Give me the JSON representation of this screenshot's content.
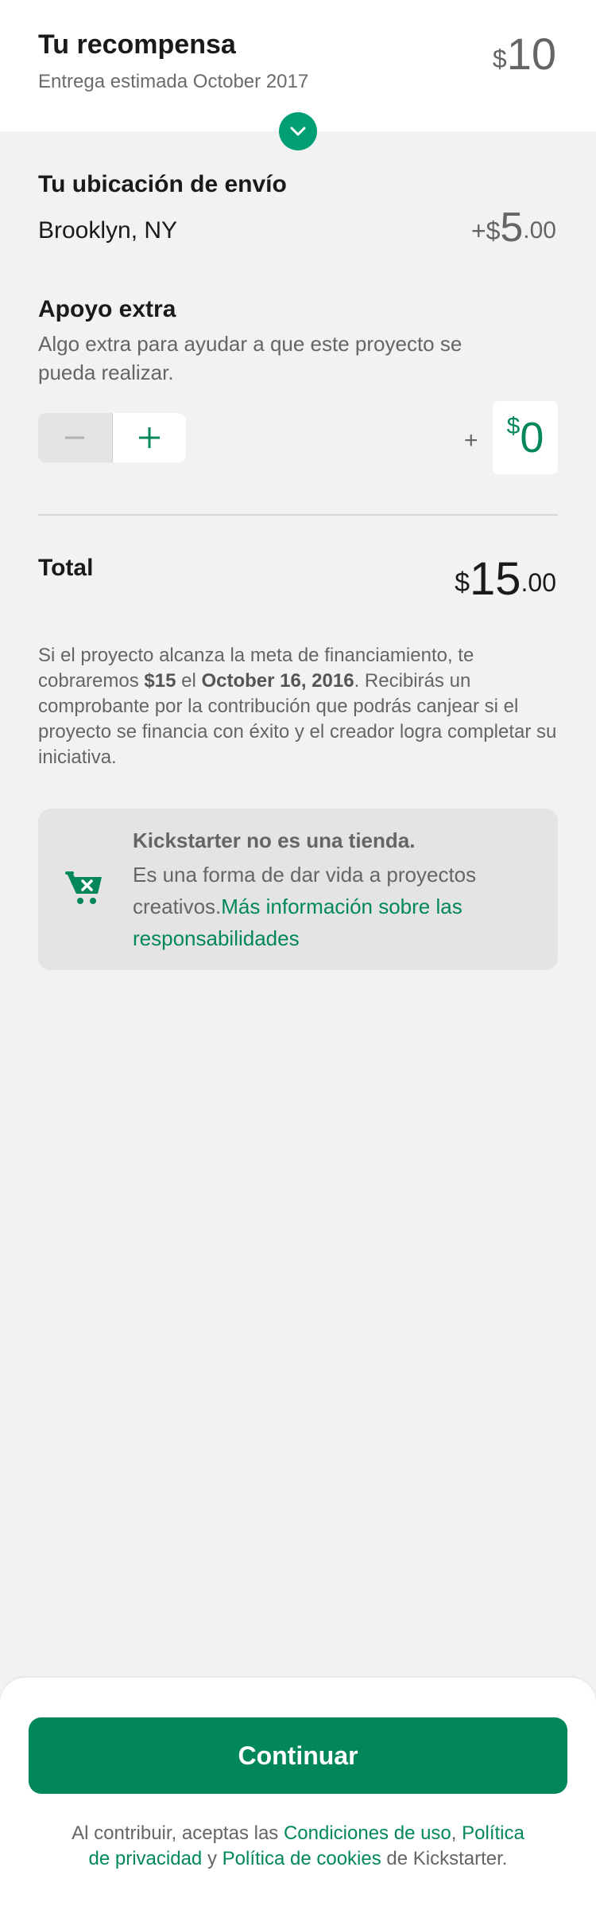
{
  "reward": {
    "title": "Tu recompensa",
    "delivery": "Entrega estimada October 2017",
    "currency": "$",
    "amount": "10"
  },
  "shipping": {
    "title": "Tu ubicación de envío",
    "location": "Brooklyn, NY",
    "sign": "+$",
    "amount": "5",
    "cents": ".00"
  },
  "extra": {
    "title": "Apoyo extra",
    "description": "Algo extra para ayudar a que este proyecto se pueda realizar.",
    "plus": "+",
    "currency": "$",
    "amount": "0"
  },
  "total": {
    "label": "Total",
    "currency": "$",
    "amount": "15",
    "cents": ".00"
  },
  "legal": {
    "part1": "Si el proyecto alcanza la meta de financiamiento, te cobraremos ",
    "amount": "$15",
    "part2": " el ",
    "date": "October 16, 2016",
    "part3": ". Recibirás un comprobante por la contribución que podrás canjear si el proyecto se financia con éxito y el creador logra completar su iniciativa."
  },
  "notice": {
    "icon": "cart-x-icon",
    "title": "Kickstarter no es una tienda.",
    "body": "Es una forma de dar vida a proyectos creativos.",
    "link": "Más información sobre las responsabilidades"
  },
  "footer": {
    "continue_label": "Continuar",
    "terms_prefix": "Al contribuir, aceptas las ",
    "terms_link": "Condiciones de uso",
    "comma": ",",
    "privacy_link": "Política de privacidad",
    "and": " y ",
    "cookies_link": "Política de cookies",
    "suffix": " de Kickstarter."
  },
  "colors": {
    "accent": "#028858",
    "toggle": "#009e74",
    "background": "#f2f2f2",
    "card": "#e4e4e4"
  }
}
